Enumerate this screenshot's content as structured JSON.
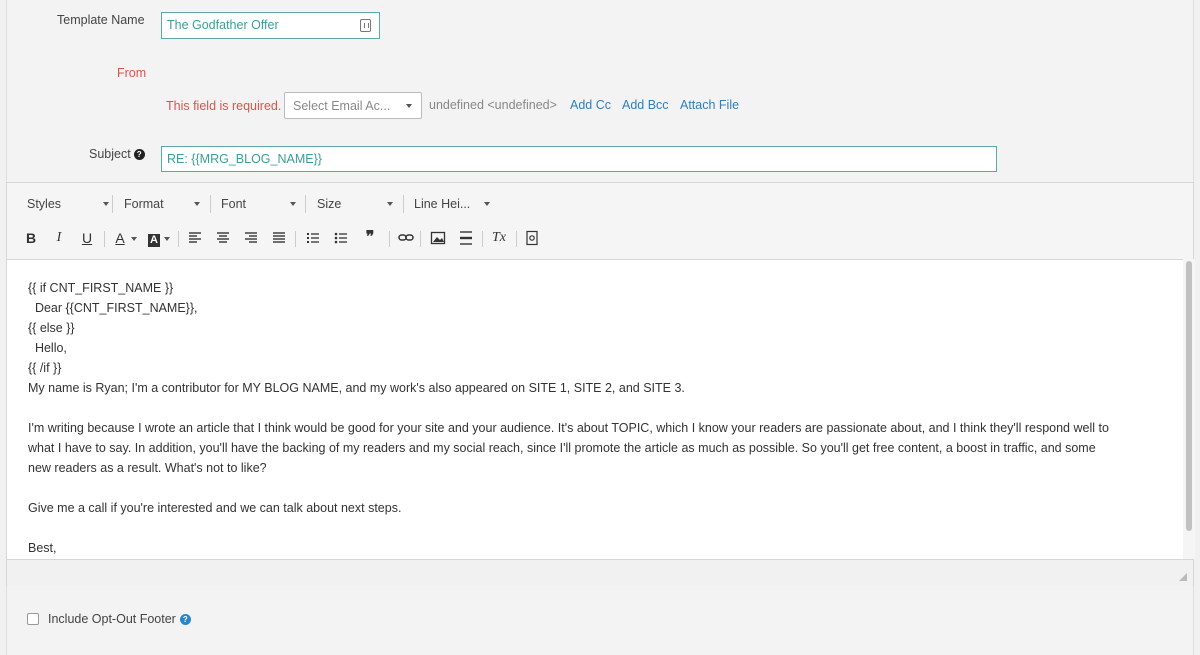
{
  "form": {
    "template_name_label": "Template Name",
    "template_name_value": "The Godfather Offer",
    "from_label": "From",
    "from_error": "This field is required.",
    "from_select_value": "Select Email Ac...",
    "from_undefined": "undefined <undefined>",
    "add_cc": "Add Cc",
    "add_bcc": "Add Bcc",
    "attach_file": "Attach File",
    "subject_label": "Subject",
    "subject_value": "RE: {{MRG_BLOG_NAME}}"
  },
  "toolbar": {
    "styles": "Styles",
    "format": "Format",
    "font": "Font",
    "size": "Size",
    "line_height": "Line Hei...",
    "buttons": {
      "bold": "B",
      "italic": "I",
      "underline": "U",
      "text_color": "A",
      "bg_color": "A",
      "blockquote": "❞",
      "remove_format": "Tx"
    }
  },
  "body": {
    "lines": [
      "{{ if CNT_FIRST_NAME }}",
      "  Dear {{CNT_FIRST_NAME}},",
      "{{ else }}",
      "  Hello,",
      "{{ /if }}",
      "My name is Ryan; I'm a contributor for MY BLOG NAME, and my work's also appeared on SITE 1, SITE 2, and SITE 3.",
      "",
      "I'm writing because I wrote an article that I think would be good for your site and your audience. It's about TOPIC, which I know your readers are passionate about, and I think they'll respond well to",
      "what I have to say. In addition, you'll have the backing of my readers and my social reach, since I'll promote the article as much as possible. So you'll get free content, a boost in traffic, and some",
      "new readers as a result. What's not to like?",
      "",
      "Give me a call if you're interested and we can talk about next steps.",
      "",
      "Best,"
    ]
  },
  "footer": {
    "opt_out_label": "Include Opt-Out Footer",
    "opt_out_checked": false
  },
  "colors": {
    "accent_teal": "#3a9f98",
    "error_red": "#d9534f",
    "link_blue": "#2f7fbf"
  }
}
